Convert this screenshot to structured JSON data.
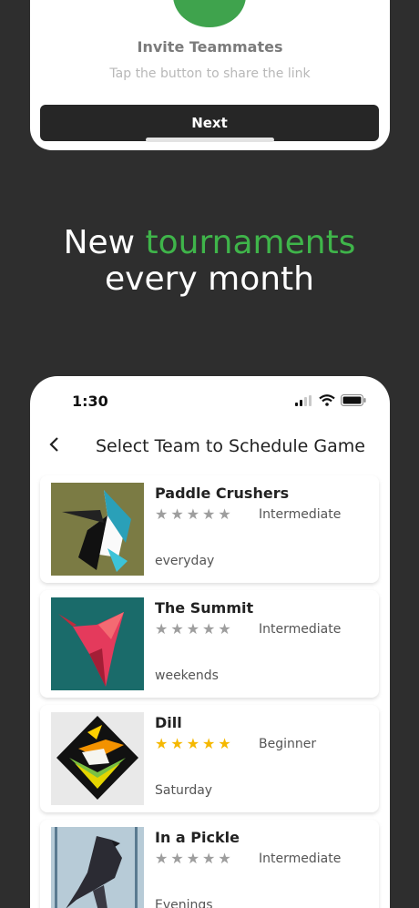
{
  "invite": {
    "title": "Invite Teammates",
    "subtitle": "Tap the button to share the link",
    "next_label": "Next"
  },
  "headline": {
    "part1": "New ",
    "accent": "tournaments",
    "part2": "every month",
    "accent_color": "#3fb54a"
  },
  "status_bar": {
    "time": "1:30"
  },
  "header": {
    "back_icon": "chevron-left-icon",
    "title": "Select Team to Schedule Game"
  },
  "teams": [
    {
      "name": "Paddle Crushers",
      "level": "Intermediate",
      "schedule": "everyday",
      "rating": 0
    },
    {
      "name": "The Summit",
      "level": "Intermediate",
      "schedule": "weekends",
      "rating": 0
    },
    {
      "name": "Dill",
      "level": "Beginner",
      "schedule": "Saturday",
      "rating": 5
    },
    {
      "name": "In a Pickle",
      "level": "Intermediate",
      "schedule": "Evenings",
      "rating": 0
    }
  ],
  "colors": {
    "background": "#2e2e2e",
    "accent_green": "#3fa34d",
    "star_gold": "#f5b800",
    "star_gray": "#9e9e9e"
  }
}
